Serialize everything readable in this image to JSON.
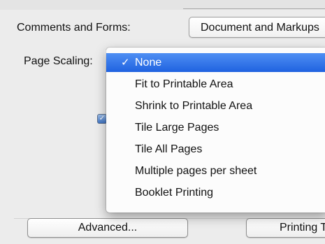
{
  "comments_forms": {
    "label": "Comments and Forms:",
    "value": "Document and Markups"
  },
  "page_scaling": {
    "label": "Page Scaling:",
    "options": [
      {
        "label": "None",
        "selected": true
      },
      {
        "label": "Fit to Printable Area",
        "selected": false
      },
      {
        "label": "Shrink to Printable Area",
        "selected": false
      },
      {
        "label": "Tile Large Pages",
        "selected": false
      },
      {
        "label": "Tile All Pages",
        "selected": false
      },
      {
        "label": "Multiple pages per sheet",
        "selected": false
      },
      {
        "label": "Booklet Printing",
        "selected": false
      }
    ],
    "check_mark": "✓"
  },
  "checkbox": {
    "mark": "✓"
  },
  "buttons": {
    "advanced": "Advanced...",
    "printing": "Printing Tips"
  },
  "colors": {
    "selection": "#2f6fe6",
    "window_bg": "#ececec"
  }
}
